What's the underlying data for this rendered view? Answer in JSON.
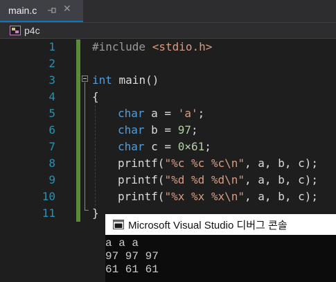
{
  "tab": {
    "title": "main.c",
    "pin_icon": "pin-icon",
    "close_icon": "close-icon",
    "close_glyph": "✕"
  },
  "nav": {
    "project_icon": "project-icon",
    "project": "p4c"
  },
  "editor": {
    "line_numbers": [
      "1",
      "2",
      "3",
      "4",
      "5",
      "6",
      "7",
      "8",
      "9",
      "10",
      "11"
    ],
    "lines": {
      "l1": {
        "pp": "#include ",
        "str": "<stdio.h>"
      },
      "l3": {
        "type": "int",
        "rest": " main()"
      },
      "l4": {
        "text": "{"
      },
      "l5": {
        "type": "char",
        "mid": " a = ",
        "str": "'a'",
        "end": ";"
      },
      "l6": {
        "type": "char",
        "mid": " b = ",
        "num": "97",
        "end": ";"
      },
      "l7": {
        "type": "char",
        "mid": " c = ",
        "num": "0×61",
        "end": ";"
      },
      "l8": {
        "fn": "printf(",
        "str": "\"%c %c %c\\n\"",
        "end": ", a, b, c);"
      },
      "l9": {
        "fn": "printf(",
        "str": "\"%d %d %d\\n\"",
        "end": ", a, b, c);"
      },
      "l10": {
        "fn": "printf(",
        "str": "\"%x %x %x\\n\"",
        "end": ", a, b, c);"
      },
      "l11": {
        "text": "}"
      }
    }
  },
  "console": {
    "icon": "console-window-icon",
    "title": "Microsoft Visual Studio 디버그 콘솔",
    "output": [
      "a a a",
      "97 97 97",
      "61 61 61"
    ]
  },
  "colors": {
    "keyword": "#569cd6",
    "string": "#d69d85",
    "number": "#b5cea8",
    "preprocessor": "#9b9b9b",
    "line_number": "#2b91af",
    "change_bar": "#5d8a35",
    "tab_accent": "#007acc"
  }
}
